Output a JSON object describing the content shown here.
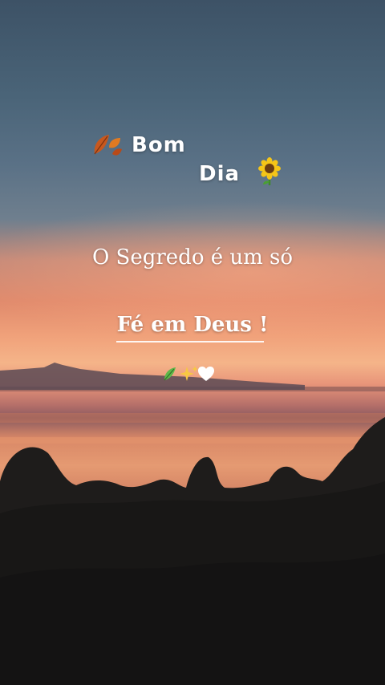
{
  "greeting": {
    "line1": "Bom",
    "line2": "Dia"
  },
  "message": {
    "line": "O Segredo é um só",
    "highlight": "Fé em Deus !"
  },
  "icons": {
    "leaf": "autumn-leaves-icon",
    "sunflower": "sunflower-icon",
    "herb": "herb-icon",
    "sparkles": "sparkles-icon",
    "heart": "white-heart-icon"
  },
  "colors": {
    "text": "#ffffff",
    "sky_top": "#3d5266",
    "sunset": "#f0a17a",
    "foliage": "#1d1b1a"
  }
}
